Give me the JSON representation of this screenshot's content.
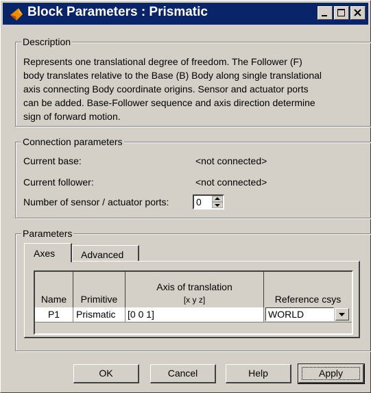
{
  "window": {
    "title": "Block Parameters : Prismatic",
    "controls": [
      "minimize-icon",
      "maximize-icon",
      "close-icon"
    ]
  },
  "description": {
    "legend": "Description",
    "lines": [
      "Represents one translational degree of freedom. The Follower (F)",
      "body translates relative to the Base (B) Body along single translational",
      "axis connecting Body coordinate origins. Sensor and actuator ports",
      "can be added. Base-Follower sequence and axis direction determine",
      "sign of forward motion."
    ]
  },
  "connection": {
    "legend": "Connection parameters",
    "current_base_label": "Current base:",
    "current_base_value": "<not connected>",
    "current_follower_label": "Current follower:",
    "current_follower_value": "<not connected>",
    "ports_label": "Number of sensor / actuator ports:",
    "ports_value": "0"
  },
  "parameters": {
    "legend": "Parameters",
    "tabs": [
      {
        "label": "Axes",
        "active": true
      },
      {
        "label": "Advanced",
        "active": false
      }
    ],
    "table": {
      "headers": {
        "name": "Name",
        "primitive": "Primitive",
        "axis_line1": "Axis of translation",
        "axis_line2": "[x y z]",
        "ref": "Reference csys"
      },
      "rows": [
        {
          "name": "P1",
          "primitive": "Prismatic",
          "axis": "[0 0 1]",
          "ref": "WORLD"
        }
      ]
    }
  },
  "buttons": {
    "ok": "OK",
    "cancel": "Cancel",
    "help": "Help",
    "apply": "Apply"
  },
  "colors": {
    "title_bar": "#0a246a",
    "face": "#d4d0c8",
    "icon_orange": "#f08a00"
  }
}
